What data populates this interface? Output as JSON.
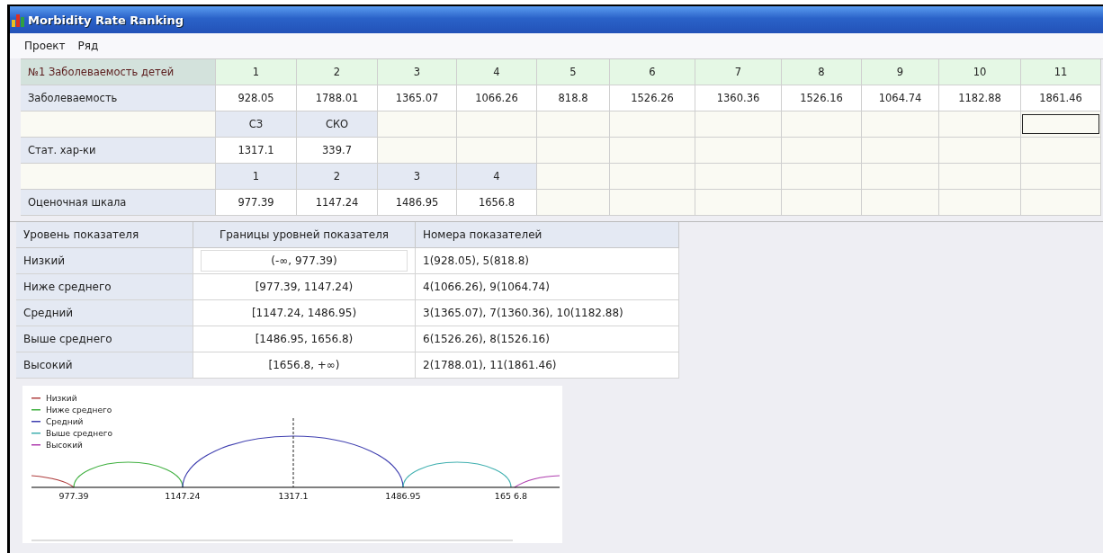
{
  "window": {
    "title": "Morbidity Rate Ranking"
  },
  "menu": [
    "Проект",
    "Ряд"
  ],
  "grid": {
    "rows": [
      {
        "kind": "header",
        "label": "№1 Заболеваемость детей",
        "cells": [
          "1",
          "2",
          "3",
          "4",
          "5",
          "6",
          "7",
          "8",
          "9",
          "10",
          "11"
        ]
      },
      {
        "kind": "values",
        "label": "Заболеваемость",
        "cells": [
          "928.05",
          "1788.01",
          "1365.07",
          "1066.26",
          "818.8",
          "1526.26",
          "1360.36",
          "1526.16",
          "1064.74",
          "1182.88",
          "1861.46"
        ]
      },
      {
        "kind": "subheader",
        "cells": [
          "СЗ",
          "СКО"
        ],
        "blank_cells": [
          {
            "selected": false
          },
          {
            "selected": false
          },
          {
            "selected": false
          },
          {
            "selected": false
          },
          {
            "selected": false
          },
          {
            "selected": false
          },
          {
            "selected": false
          },
          {
            "selected": false
          },
          {
            "selected": true
          }
        ]
      },
      {
        "kind": "values",
        "label": "Стат. хар-ки",
        "cells": [
          "1317.1",
          "339.7"
        ]
      },
      {
        "kind": "subheader",
        "cells": [
          "1",
          "2",
          "3",
          "4"
        ]
      },
      {
        "kind": "values",
        "label": "Оценочная шкала",
        "cells": [
          "977.39",
          "1147.24",
          "1486.95",
          "1656.8"
        ]
      }
    ]
  },
  "levels_table": {
    "columns": [
      "Уровень показателя",
      "Границы уровней показателя",
      "Номера показателей"
    ],
    "rows": [
      {
        "level": "Низкий",
        "bounds": "(-∞, 977.39)",
        "indices": "1(928.05), 5(818.8)",
        "focused": true
      },
      {
        "level": "Ниже среднего",
        "bounds": "[977.39, 1147.24)",
        "indices": "4(1066.26), 9(1064.74)",
        "focused": false
      },
      {
        "level": "Средний",
        "bounds": "[1147.24, 1486.95)",
        "indices": "3(1365.07), 7(1360.36), 10(1182.88)",
        "focused": false
      },
      {
        "level": "Выше среднего",
        "bounds": "[1486.95, 1656.8)",
        "indices": "6(1526.26), 8(1526.16)",
        "focused": false
      },
      {
        "level": "Высокий",
        "bounds": "[1656.8, +∞)",
        "indices": "2(1788.01), 11(1861.46)",
        "focused": false
      }
    ]
  },
  "diagram": {
    "legend": [
      {
        "label": "Низкий",
        "color": "#b04040"
      },
      {
        "label": "Ниже среднего",
        "color": "#40b040"
      },
      {
        "label": "Средний",
        "color": "#4040b0"
      },
      {
        "label": "Выше среднего",
        "color": "#40b0b0"
      },
      {
        "label": "Высокий",
        "color": "#b040b0"
      }
    ],
    "ticks": [
      "977.39",
      "1147.24",
      "1317.1",
      "1486.95",
      "165 6.8"
    ]
  }
}
